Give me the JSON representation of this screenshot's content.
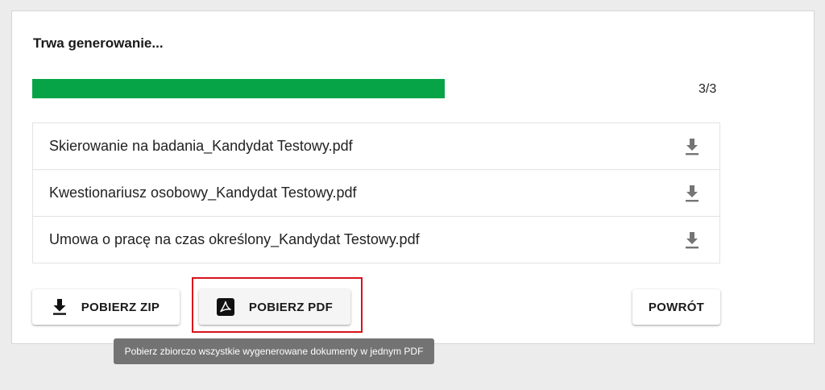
{
  "panel": {
    "title": "Trwa generowanie...",
    "progress": {
      "label": "3/3",
      "fraction": 0.6
    }
  },
  "files": [
    {
      "name": "Skierowanie na badania_Kandydat Testowy.pdf",
      "icon": "download-icon"
    },
    {
      "name": "Kwestionariusz osobowy_Kandydat Testowy.pdf",
      "icon": "download-icon"
    },
    {
      "name": "Umowa o pracę na czas określony_Kandydat Testowy.pdf",
      "icon": "download-icon"
    }
  ],
  "actions": {
    "zip_label": "POBIERZ ZIP",
    "zip_icon": "download-icon",
    "pdf_label": "POBIERZ PDF",
    "pdf_icon": "pdf-icon",
    "back_label": "POWRÓT"
  },
  "tooltip": {
    "text": "Pobierz zbiorczo wszystkie wygenerowane dokumenty w jednym PDF"
  },
  "colors": {
    "progress": "#06a447",
    "highlight": "#d9131c",
    "tooltip_bg": "#737373"
  }
}
